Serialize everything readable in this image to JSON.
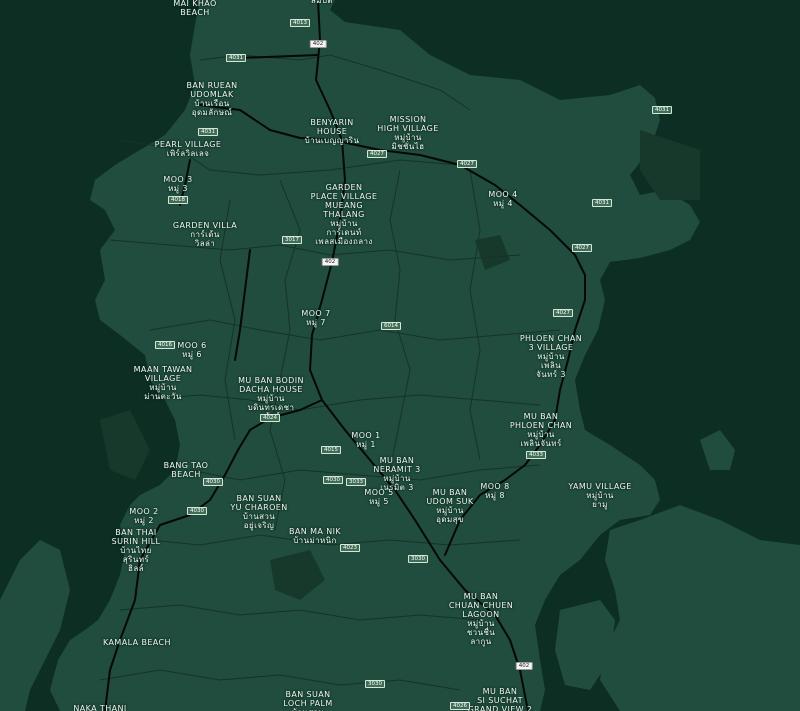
{
  "map": {
    "colors": {
      "water": "#0d2e22",
      "land": "#204d3d",
      "park": "#16392c",
      "road_major": "#050807",
      "road_minor": "#163327"
    },
    "places": [
      {
        "id": "mai-khao-beach",
        "lines": [
          "MAI KHAO",
          "BEACH"
        ]
      },
      {
        "id": "top-cut-label",
        "lines": [
          "สมบัติ"
        ]
      },
      {
        "id": "ban-ruean-udomlak",
        "lines": [
          "BAN RUEAN",
          "UDOMLAK",
          "บ้านเรือน",
          "อุดมลักษณ์"
        ]
      },
      {
        "id": "benyarin-house",
        "lines": [
          "BENYARIN",
          "HOUSE",
          "บ้านเบญญาริน"
        ]
      },
      {
        "id": "mission-high-village",
        "lines": [
          "MISSION",
          "HIGH VILLAGE",
          "หมู่บ้าน",
          "มิชชั่นไฮ"
        ]
      },
      {
        "id": "pearl-village",
        "lines": [
          "PEARL VILLAGE",
          "เพิร์ลวิลเลจ"
        ]
      },
      {
        "id": "moo-3",
        "lines": [
          "MOO 3",
          "หมู่ 3"
        ]
      },
      {
        "id": "garden-place-village",
        "lines": [
          "GARDEN",
          "PLACE VILLAGE",
          "MUEANG",
          "THALANG",
          "หมู่บ้าน",
          "การ์เดนท์",
          "เพลสเมืองถลาง"
        ]
      },
      {
        "id": "moo-4",
        "lines": [
          "MOO 4",
          "หมู่ 4"
        ]
      },
      {
        "id": "garden-villa",
        "lines": [
          "GARDEN VILLA",
          "การ์เด้น",
          "วิลล่า"
        ]
      },
      {
        "id": "moo-7",
        "lines": [
          "MOO 7",
          "หมู่ 7"
        ]
      },
      {
        "id": "phloen-chan-3",
        "lines": [
          "PHLOEN CHAN",
          "3 VILLAGE",
          "หมู่บ้าน",
          "เพลิน",
          "จันทร์ 3"
        ]
      },
      {
        "id": "moo-6",
        "lines": [
          "MOO 6",
          "หมู่ 6"
        ]
      },
      {
        "id": "maan-tawan-village",
        "lines": [
          "MAAN TAWAN",
          "VILLAGE",
          "หมู่บ้าน",
          "ม่านตะวัน"
        ]
      },
      {
        "id": "mu-ban-bodin-dacha",
        "lines": [
          "MU BAN BODIN",
          "DACHA HOUSE",
          "หมู่บ้าน",
          "บดินทรเดชา",
          "เฮ้าส์"
        ]
      },
      {
        "id": "mu-ban-phloen-chan",
        "lines": [
          "MU BAN",
          "PHLOEN CHAN",
          "หมู่บ้าน",
          "เพลินจันทร์"
        ]
      },
      {
        "id": "moo-1",
        "lines": [
          "MOO 1",
          "หมู่ 1"
        ]
      },
      {
        "id": "neramit-3",
        "lines": [
          "MU BAN",
          "NERAMIT 3",
          "หมู่บ้าน",
          "เนรมิต 3"
        ]
      },
      {
        "id": "bang-tao-beach",
        "lines": [
          "BANG TAO",
          "BEACH"
        ]
      },
      {
        "id": "moo-5",
        "lines": [
          "MOO 5",
          "หมู่ 5"
        ]
      },
      {
        "id": "moo-8",
        "lines": [
          "MOO 8",
          "หมู่ 8"
        ]
      },
      {
        "id": "yamu-village",
        "lines": [
          "YAMU VILLAGE",
          "หมู่บ้าน",
          "ยามู"
        ]
      },
      {
        "id": "udom-suk",
        "lines": [
          "MU BAN",
          "UDOM SUK",
          "หมู่บ้าน",
          "อุดมสุข"
        ]
      },
      {
        "id": "ban-suan-yu-charoen",
        "lines": [
          "BAN SUAN",
          "YU CHAROEN",
          "บ้านสวน",
          "อยู่เจริญ"
        ]
      },
      {
        "id": "moo-2",
        "lines": [
          "MOO 2",
          "หมู่ 2"
        ]
      },
      {
        "id": "ban-thai-surin-hill",
        "lines": [
          "BAN THAI",
          "SURIN HILL",
          "บ้านไทย",
          "สุรินทร์",
          "ฮิลล์"
        ]
      },
      {
        "id": "ban-ma-nik",
        "lines": [
          "BAN MA NIK",
          "บ้านม่าหนิก"
        ]
      },
      {
        "id": "chuan-chuen-lagoon",
        "lines": [
          "MU BAN",
          "CHUAN CHUEN",
          "LAGOON",
          "หมู่บ้าน",
          "ชวนชื่น",
          "ลากูน"
        ]
      },
      {
        "id": "kamala-beach",
        "lines": [
          "KAMALA BEACH"
        ]
      },
      {
        "id": "ban-suan-loch-palm",
        "lines": [
          "BAN SUAN",
          "LOCH PALM",
          "บ้านสวน"
        ]
      },
      {
        "id": "mu-ban-si-suchat",
        "lines": [
          "MU BAN",
          "SI SUCHAT",
          "GRAND VIEW 2"
        ]
      },
      {
        "id": "naka-thani",
        "lines": [
          "NAKA THANI"
        ]
      }
    ],
    "shields": [
      {
        "id": "s-4013-top",
        "label": "4013"
      },
      {
        "id": "s-402-top",
        "label": "402"
      },
      {
        "id": "s-4031-a",
        "label": "4031"
      },
      {
        "id": "s-4031-b",
        "label": "4031"
      },
      {
        "id": "s-4031-c",
        "label": "4031"
      },
      {
        "id": "s-4031-d",
        "label": "4031"
      },
      {
        "id": "s-4027-a",
        "label": "4027"
      },
      {
        "id": "s-4027-b",
        "label": "4027"
      },
      {
        "id": "s-4027-c",
        "label": "4027"
      },
      {
        "id": "s-4027-d",
        "label": "4027"
      },
      {
        "id": "s-4018",
        "label": "4018"
      },
      {
        "id": "s-3017",
        "label": "3017"
      },
      {
        "id": "s-402-mid",
        "label": "402"
      },
      {
        "id": "s-6014",
        "label": "6014"
      },
      {
        "id": "s-4016",
        "label": "4016"
      },
      {
        "id": "s-4024",
        "label": "4024"
      },
      {
        "id": "s-4015",
        "label": "4015"
      },
      {
        "id": "s-4033",
        "label": "4033"
      },
      {
        "id": "s-4030-a",
        "label": "4030"
      },
      {
        "id": "s-4030-b",
        "label": "4030"
      },
      {
        "id": "s-4030-c",
        "label": "4030"
      },
      {
        "id": "s-3033",
        "label": "3033"
      },
      {
        "id": "s-4023",
        "label": "4023"
      },
      {
        "id": "s-3030-a",
        "label": "3030"
      },
      {
        "id": "s-3030-b",
        "label": "3030"
      },
      {
        "id": "s-402-bottom",
        "label": "402"
      },
      {
        "id": "s-4026",
        "label": "4026"
      }
    ]
  }
}
